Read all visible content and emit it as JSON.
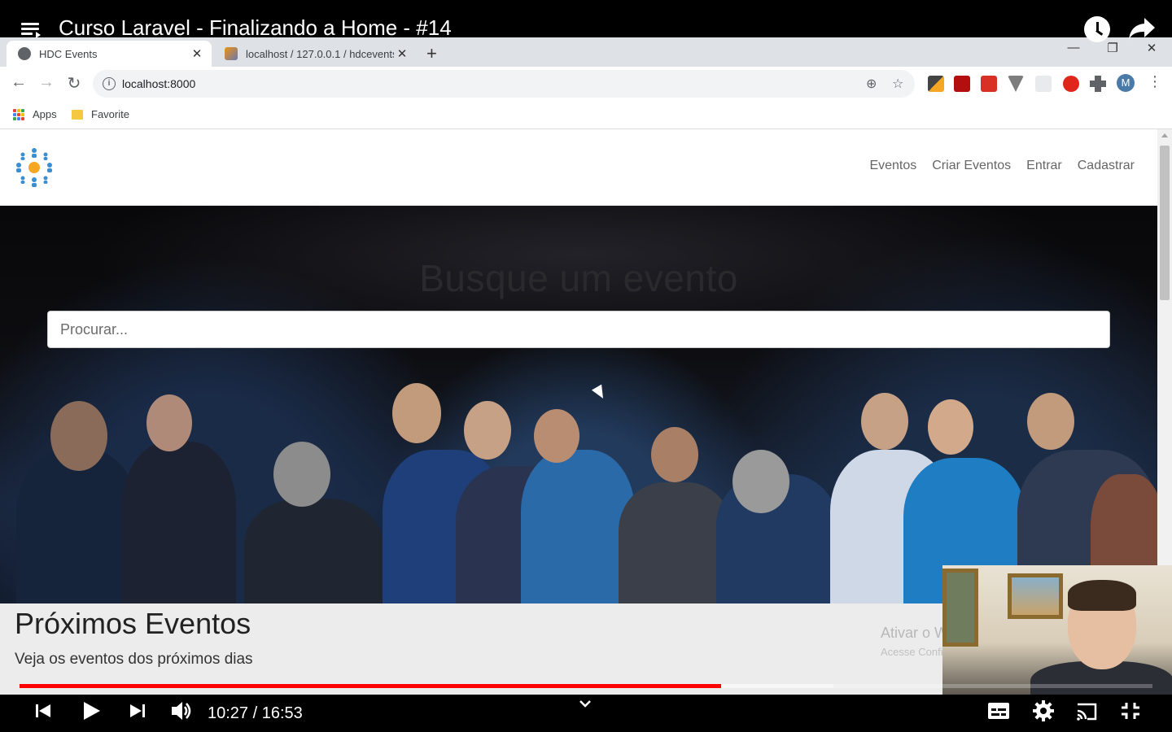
{
  "youtube": {
    "video_title": "Curso Laravel - Finalizando a Home - #14",
    "current_time": "10:27",
    "duration": "16:53",
    "time_display": "10:27 / 16:53",
    "progress_fraction": 0.619
  },
  "browser": {
    "tabs": [
      {
        "title": "HDC Events",
        "active": true
      },
      {
        "title": "localhost / 127.0.0.1 / hdcevents",
        "active": false
      }
    ],
    "url": "localhost:8000",
    "bookmarks": [
      {
        "label": "Apps"
      },
      {
        "label": "Favorite"
      }
    ],
    "profile_initial": "M"
  },
  "site": {
    "nav": [
      "Eventos",
      "Criar Eventos",
      "Entrar",
      "Cadastrar"
    ],
    "hero_title": "Busque um evento",
    "search_placeholder": "Procurar...",
    "section_title": "Próximos Eventos",
    "section_subtitle": "Veja os eventos dos próximos dias"
  },
  "os_watermark": {
    "line1": "Ativar o Windows",
    "line2": "Acesse Configurações para ativar o Windows."
  },
  "colors": {
    "progress": "#ff0000",
    "logo_center": "#f5a623",
    "logo_people": "#3a8fd1"
  }
}
